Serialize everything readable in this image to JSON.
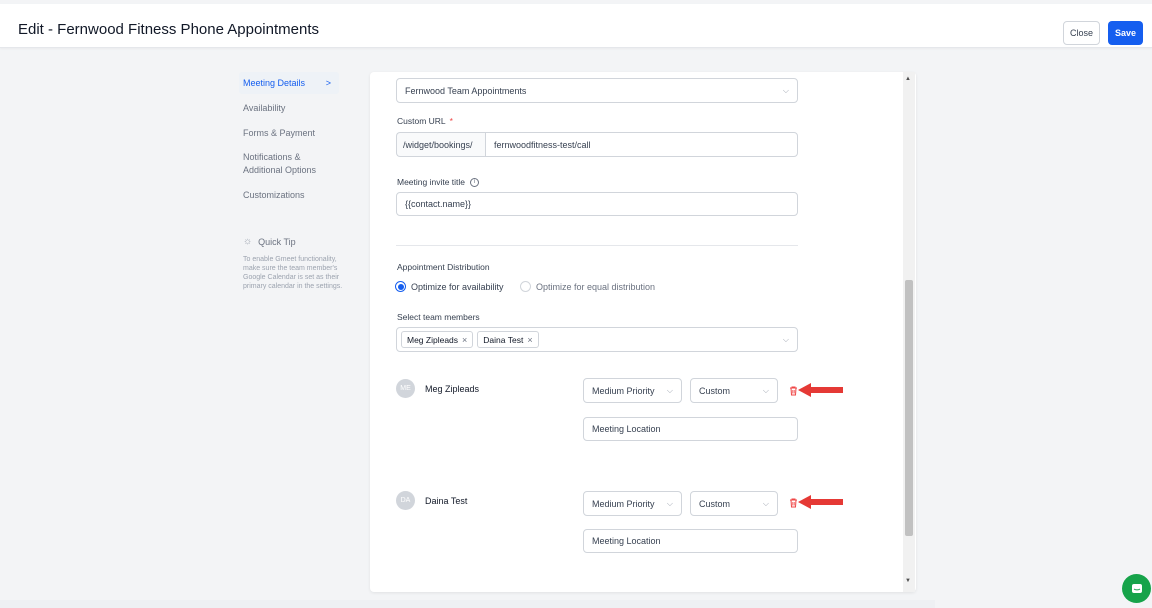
{
  "header": {
    "title": "Edit - Fernwood Fitness Phone Appointments",
    "close_label": "Close",
    "save_label": "Save"
  },
  "sidebar": {
    "items": [
      {
        "label": "Meeting Details",
        "active": true
      },
      {
        "label": "Availability"
      },
      {
        "label": "Forms & Payment"
      },
      {
        "label": "Notifications & Additional Options"
      },
      {
        "label": "Customizations"
      }
    ],
    "tip_title": "Quick Tip",
    "tip_text": "To enable Gmeet functionality, make sure the team member's Google Calendar is set as their primary calendar in the settings."
  },
  "form": {
    "team_select_value": "Fernwood Team Appointments",
    "custom_url_label": "Custom URL",
    "custom_url_required": "*",
    "custom_url_prefix": "/widget/bookings/",
    "custom_url_value": "fernwoodfitness-test/call",
    "invite_title_label": "Meeting invite title",
    "invite_title_value": "{{contact.name}}",
    "distribution_label": "Appointment Distribution",
    "distribution_options": [
      {
        "label": "Optimize for availability",
        "selected": true
      },
      {
        "label": "Optimize for equal distribution",
        "selected": false
      }
    ],
    "team_members_label": "Select team members",
    "team_member_chips": [
      "Meg Zipleads",
      "Daina Test"
    ],
    "members": [
      {
        "initials": "ME",
        "name": "Meg Zipleads",
        "priority": "Medium Priority",
        "location_type": "Custom",
        "location_placeholder": "Meeting Location"
      },
      {
        "initials": "DA",
        "name": "Daina Test",
        "priority": "Medium Priority",
        "location_type": "Custom",
        "location_placeholder": "Meeting Location"
      }
    ]
  },
  "colors": {
    "accent": "#155eef",
    "annotation_arrow": "#e53935",
    "chat_bubble": "#16a34a"
  }
}
